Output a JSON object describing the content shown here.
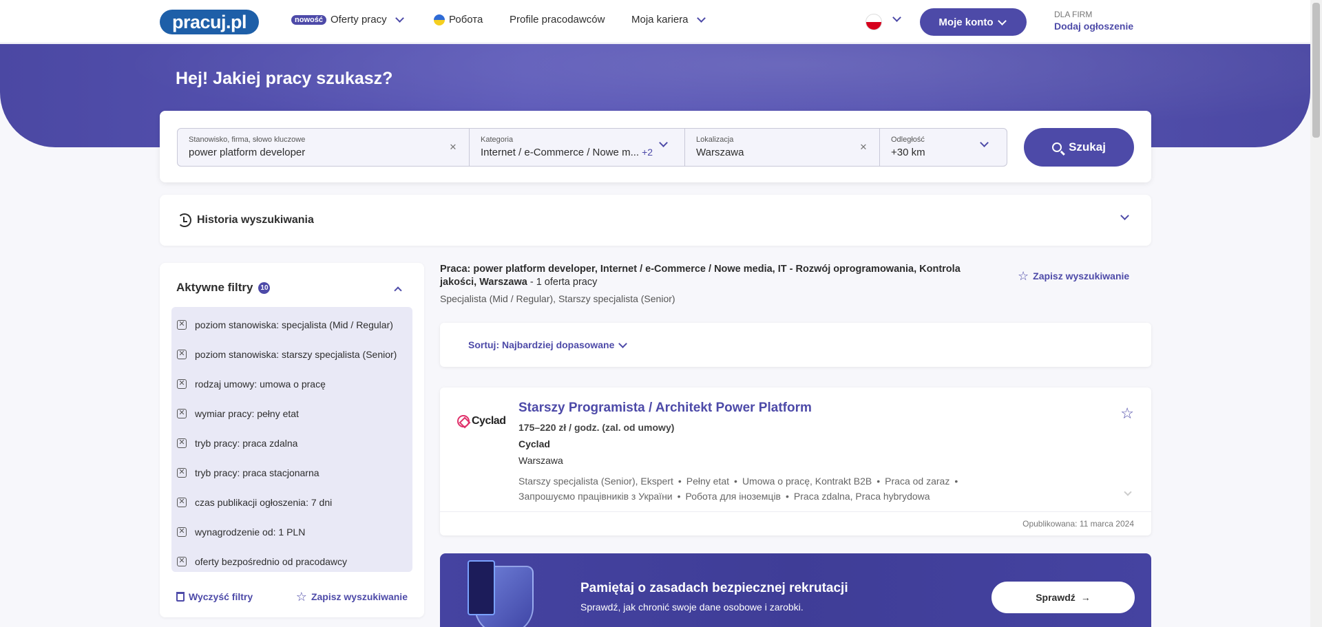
{
  "nav": {
    "logo": "pracuj.pl",
    "new_badge": "nowość",
    "offers": "Oferty pracy",
    "ua": "Робота",
    "employers": "Profile pracodawców",
    "career": "Moja kariera",
    "account": "Moje konto",
    "firm_label": "DLA FIRM",
    "firm_link": "Dodaj ogłoszenie"
  },
  "hero": {
    "title": "Hej! Jakiej pracy szukasz?"
  },
  "search": {
    "keyword_label": "Stanowisko, firma, słowo kluczowe",
    "keyword_value": "power platform developer",
    "category_label": "Kategoria",
    "category_value": "Internet / e-Commerce / Nowe m...",
    "category_more": "+2",
    "location_label": "Lokalizacja",
    "location_value": "Warszawa",
    "distance_label": "Odległość",
    "distance_value": "+30 km",
    "button": "Szukaj"
  },
  "history": {
    "title": "Historia wyszukiwania"
  },
  "filters": {
    "title": "Aktywne filtry",
    "count": "10",
    "items": [
      "poziom stanowiska: specjalista (Mid / Regular)",
      "poziom stanowiska: starszy specjalista (Senior)",
      "rodzaj umowy: umowa o pracę",
      "wymiar pracy: pełny etat",
      "tryb pracy: praca zdalna",
      "tryb pracy: praca stacjonarna",
      "czas publikacji ogłoszenia: 7 dni",
      "wynagrodzenie od: 1 PLN",
      "oferty bezpośrednio od pracodawcy"
    ],
    "clear": "Wyczyść filtry",
    "save": "Zapisz wyszukiwanie"
  },
  "results": {
    "query": "Praca: power platform developer, Internet / e-Commerce / Nowe media, IT - Rozwój oprogramowania, Kontrola jakości, Warszawa",
    "count": " - 1 oferta pracy",
    "sub": "Specjalista (Mid / Regular), Starszy specjalista (Senior)",
    "save": "Zapisz wyszukiwanie",
    "sort": "Sortuj: Najbardziej dopasowane"
  },
  "job": {
    "logo_text": "Cyclad",
    "title": "Starszy Programista / Architekt Power Platform",
    "salary": "175–220 zł / godz. (zal. od umowy)",
    "company": "Cyclad",
    "city": "Warszawa",
    "tags_line1": [
      "Starszy specjalista (Senior), Ekspert",
      "Pełny etat",
      "Umowa o pracę, Kontrakt B2B",
      "Praca od zaraz",
      ""
    ],
    "tags_line2": [
      "Запрошуємо працівників з України",
      "Робота для іноземців",
      "Praca zdalna, Praca hybrydowa"
    ],
    "published": "Opublikowana: 11 marca 2024"
  },
  "banner": {
    "title": "Pamiętaj o zasadach bezpiecznej rekrutacji",
    "sub": "Sprawdź, jak chronić swoje dane osobowe i zarobki.",
    "button": "Sprawdź"
  }
}
